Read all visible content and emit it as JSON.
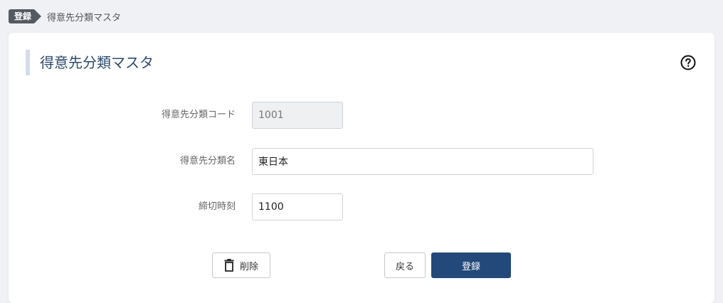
{
  "breadcrumb": {
    "badge": "登録",
    "current": "得意先分類マスタ"
  },
  "page": {
    "title": "得意先分類マスタ",
    "help_icon": "question-circle-icon"
  },
  "form": {
    "code": {
      "label": "得意先分類コード",
      "value": "1001"
    },
    "name": {
      "label": "得意先分類名",
      "value": "東日本"
    },
    "cutoff": {
      "label": "締切時刻",
      "value": "1100"
    }
  },
  "actions": {
    "delete_label": "削除",
    "back_label": "戻る",
    "submit_label": "登録"
  },
  "colors": {
    "primary": "#23487a",
    "title": "#2d4a70",
    "background": "#f0f1f5"
  }
}
